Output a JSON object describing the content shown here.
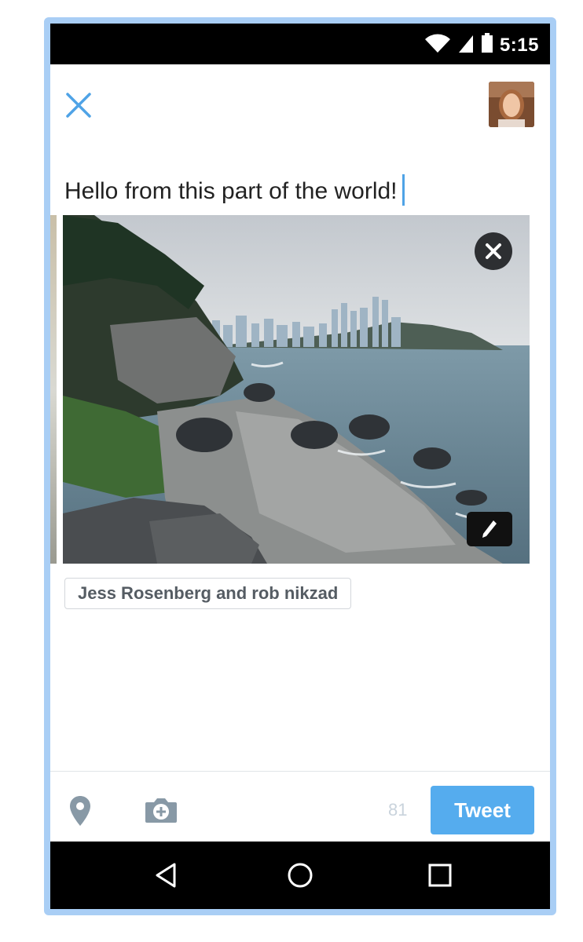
{
  "status_bar": {
    "time": "5:15",
    "icons": [
      "wifi-icon",
      "cell-signal-icon",
      "battery-icon"
    ]
  },
  "header": {
    "close_icon": "close-icon",
    "avatar_alt": "profile-avatar"
  },
  "compose": {
    "text": "Hello from this part of the world!"
  },
  "photo": {
    "remove_icon": "close-circle-icon",
    "edit_icon": "pencil-icon"
  },
  "tagged_people": "Jess Rosenberg and rob nikzad",
  "toolbar": {
    "location_icon": "location-pin-icon",
    "camera_icon": "camera-add-icon",
    "char_count": "81",
    "tweet_label": "Tweet"
  },
  "nav_bar": {
    "buttons": [
      "back-icon",
      "home-icon",
      "recents-icon"
    ]
  },
  "colors": {
    "accent": "#55acee",
    "frame": "#a9cef5",
    "status_bar": "#000000"
  }
}
